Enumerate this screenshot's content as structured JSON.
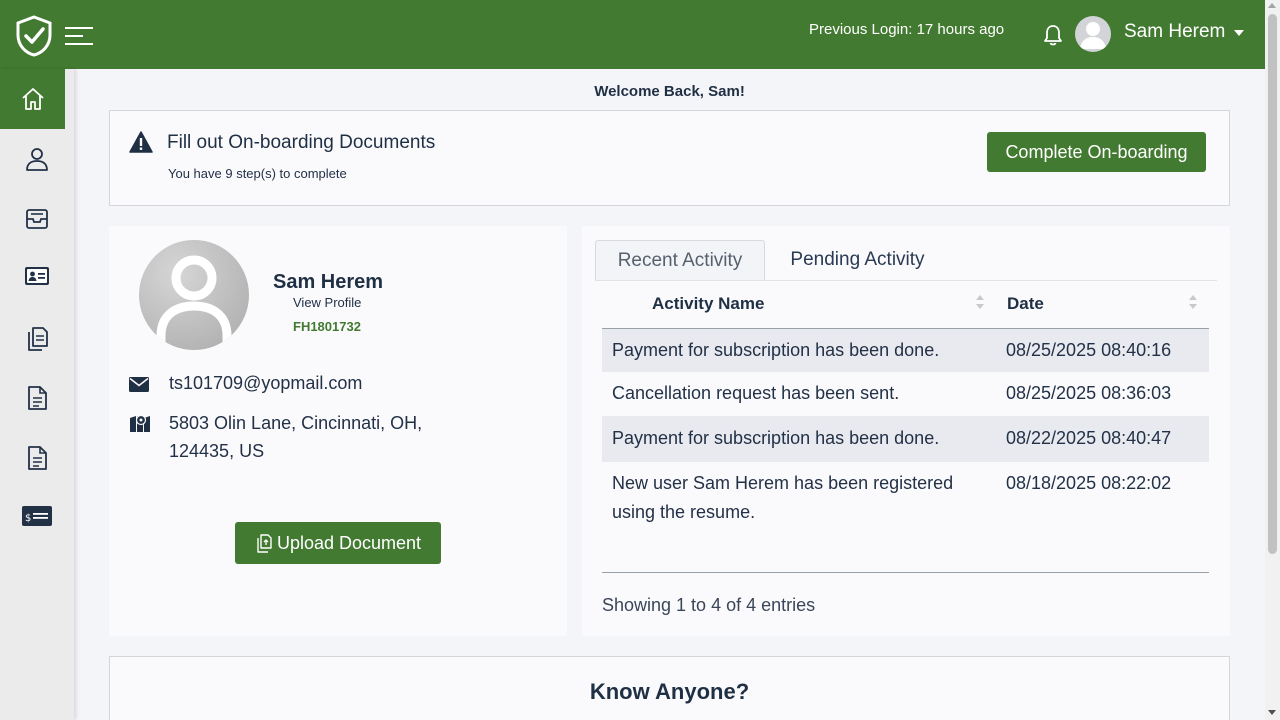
{
  "header": {
    "previous_login": "Previous Login: 17 hours ago",
    "user_name": "Sam Herem"
  },
  "sidebar": {
    "items": [
      {
        "icon": "home-icon",
        "active": true
      },
      {
        "icon": "user-icon"
      },
      {
        "icon": "inbox-icon"
      },
      {
        "icon": "id-card-icon"
      },
      {
        "icon": "documents-icon"
      },
      {
        "icon": "document-icon"
      },
      {
        "icon": "document-icon"
      },
      {
        "icon": "payment-card-icon"
      }
    ]
  },
  "welcome": "Welcome Back, Sam!",
  "onboarding": {
    "title": "Fill out On-boarding Documents",
    "subtitle": "You have 9 step(s) to complete",
    "button": "Complete On-boarding"
  },
  "profile": {
    "name": "Sam Herem",
    "view_profile": "View Profile",
    "id": "FH1801732",
    "email": "ts101709@yopmail.com",
    "address": "5803 Olin Lane, Cincinnati, OH, 124435, US",
    "upload_button": "Upload Document"
  },
  "activity": {
    "tabs": [
      "Recent Activity",
      "Pending Activity"
    ],
    "columns": [
      "Activity Name",
      "Date"
    ],
    "rows": [
      {
        "name": "Payment for subscription has been done.",
        "date": "08/25/2025 08:40:16"
      },
      {
        "name": "Cancellation request has been sent.",
        "date": "08/25/2025 08:36:03"
      },
      {
        "name": "Payment for subscription has been done.",
        "date": "08/22/2025 08:40:47"
      },
      {
        "name": "New user Sam Herem has been registered using the resume.",
        "date": "08/18/2025 08:22:02"
      }
    ],
    "entries": "Showing 1 to 4 of 4 entries"
  },
  "know_anyone": "Know Anyone?",
  "colors": {
    "brand_green": "#427a31",
    "navy": "#1f2f44",
    "sidebar_bg": "#ebebeb"
  }
}
